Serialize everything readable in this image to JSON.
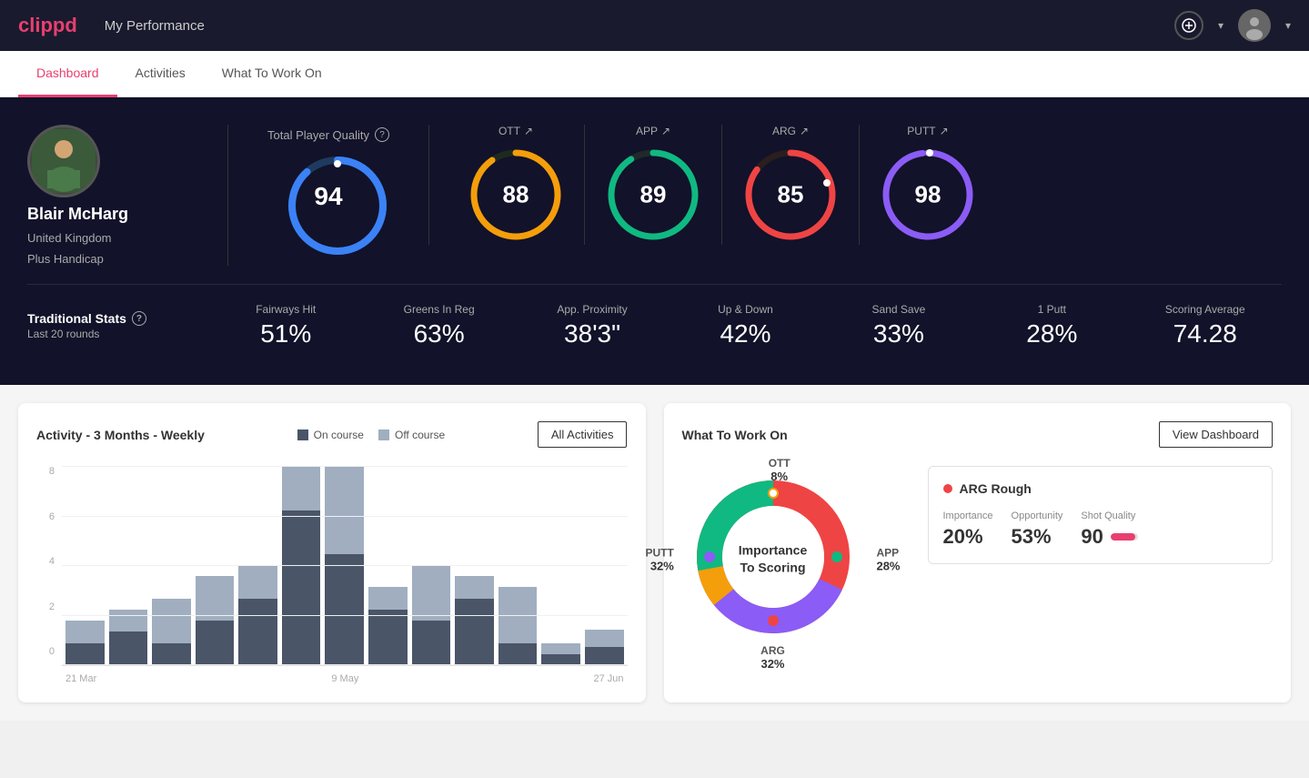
{
  "app": {
    "logo": "clippd",
    "header_title": "My Performance"
  },
  "tabs": [
    {
      "id": "dashboard",
      "label": "Dashboard",
      "active": true
    },
    {
      "id": "activities",
      "label": "Activities",
      "active": false
    },
    {
      "id": "what-to-work-on",
      "label": "What To Work On",
      "active": false
    }
  ],
  "player": {
    "name": "Blair McHarg",
    "country": "United Kingdom",
    "handicap": "Plus Handicap"
  },
  "total_quality": {
    "label": "Total Player Quality",
    "value": 94,
    "color": "#3b82f6"
  },
  "score_items": [
    {
      "id": "ott",
      "label": "OTT",
      "value": 88,
      "color": "#f59e0b"
    },
    {
      "id": "app",
      "label": "APP",
      "value": 89,
      "color": "#10b981"
    },
    {
      "id": "arg",
      "label": "ARG",
      "value": 85,
      "color": "#ef4444"
    },
    {
      "id": "putt",
      "label": "PUTT",
      "value": 98,
      "color": "#8b5cf6"
    }
  ],
  "traditional_stats": {
    "label": "Traditional Stats",
    "sublabel": "Last 20 rounds",
    "items": [
      {
        "name": "Fairways Hit",
        "value": "51%"
      },
      {
        "name": "Greens In Reg",
        "value": "63%"
      },
      {
        "name": "App. Proximity",
        "value": "38'3\""
      },
      {
        "name": "Up & Down",
        "value": "42%"
      },
      {
        "name": "Sand Save",
        "value": "33%"
      },
      {
        "name": "1 Putt",
        "value": "28%"
      },
      {
        "name": "Scoring Average",
        "value": "74.28"
      }
    ]
  },
  "activity_chart": {
    "title": "Activity - 3 Months - Weekly",
    "legend_on": "On course",
    "legend_off": "Off course",
    "all_activities_label": "All Activities",
    "x_labels": [
      "21 Mar",
      "9 May",
      "27 Jun"
    ],
    "y_labels": [
      "8",
      "6",
      "4",
      "2",
      "0"
    ],
    "bars": [
      {
        "on": 1,
        "off": 1
      },
      {
        "on": 1.5,
        "off": 1
      },
      {
        "on": 1,
        "off": 2
      },
      {
        "on": 2,
        "off": 2
      },
      {
        "on": 3,
        "off": 1.5
      },
      {
        "on": 7,
        "off": 2
      },
      {
        "on": 5,
        "off": 4
      },
      {
        "on": 2.5,
        "off": 1
      },
      {
        "on": 2,
        "off": 2.5
      },
      {
        "on": 3,
        "off": 1
      },
      {
        "on": 1,
        "off": 2.5
      },
      {
        "on": 0.5,
        "off": 0.5
      },
      {
        "on": 0.8,
        "off": 0.8
      }
    ]
  },
  "what_to_work_on": {
    "title": "What To Work On",
    "view_dashboard_label": "View Dashboard",
    "donut_center_line1": "Importance",
    "donut_center_line2": "To Scoring",
    "segments": [
      {
        "label": "OTT",
        "pct": "8%",
        "color": "#f59e0b"
      },
      {
        "label": "APP",
        "pct": "28%",
        "color": "#10b981"
      },
      {
        "label": "ARG",
        "pct": "32%",
        "color": "#ef4444"
      },
      {
        "label": "PUTT",
        "pct": "32%",
        "color": "#8b5cf6"
      }
    ],
    "detail_title": "ARG Rough",
    "detail_dot_color": "#ef4444",
    "detail_metrics": [
      {
        "label": "Importance",
        "value": "20%"
      },
      {
        "label": "Opportunity",
        "value": "53%"
      },
      {
        "label": "Shot Quality",
        "value": "90",
        "has_bar": true
      }
    ]
  }
}
